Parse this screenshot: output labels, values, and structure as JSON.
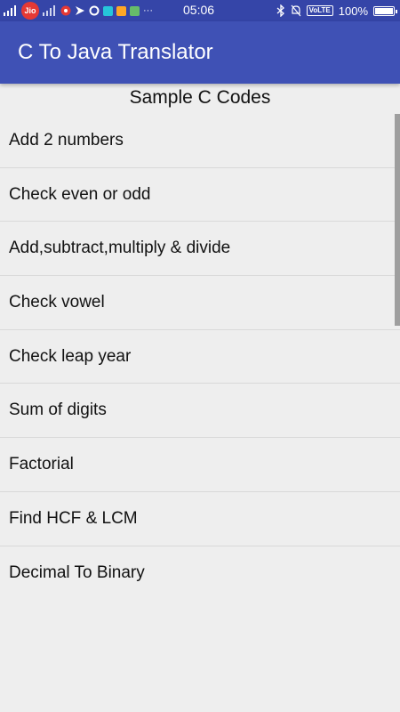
{
  "status_bar": {
    "carrier_badge": "Jio",
    "time": "05:06",
    "volte_label": "VoLTE",
    "battery": "100%",
    "more_indicator": "···"
  },
  "app_bar": {
    "title": "C To Java Translator",
    "color": "#3f51b5"
  },
  "list": {
    "header": "Sample C Codes",
    "items": [
      "Add 2 numbers",
      "Check even or odd",
      "Add,subtract,multiply & divide",
      "Check vowel",
      "Check leap year",
      "Sum of digits",
      "Factorial",
      "Find HCF & LCM",
      "Decimal To Binary"
    ]
  }
}
